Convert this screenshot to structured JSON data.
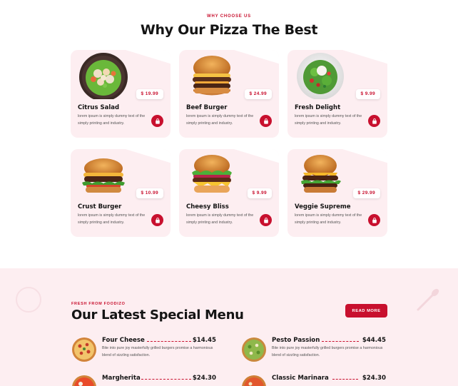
{
  "section1": {
    "eyebrow": "WHY CHOOSE US",
    "title": "Why Our Pizza The Best"
  },
  "cards": [
    {
      "name": "Citrus Salad",
      "price": "$ 19.99",
      "desc": "lorem ipsum is simply dummy text of the simply printing and industry.",
      "icon": "salad-bowl-icon"
    },
    {
      "name": "Beef Burger",
      "price": "$ 24.99",
      "desc": "lorem ipsum is simply dummy text of the simply printing and industry.",
      "icon": "burger-icon"
    },
    {
      "name": "Fresh Delight",
      "price": "$ 9.99",
      "desc": "lorem ipsum is simply dummy text of the simply printing and industry.",
      "icon": "salad-plate-icon"
    },
    {
      "name": "Crust Burger",
      "price": "$ 10.99",
      "desc": "lorem ipsum is simply dummy text of the simply printing and industry.",
      "icon": "burger-icon"
    },
    {
      "name": "Cheesy Bliss",
      "price": "$ 9.99",
      "desc": "lorem ipsum is simply dummy text of the simply printing and industry.",
      "icon": "burger-icon"
    },
    {
      "name": "Veggie Supreme",
      "price": "$ 29.99",
      "desc": "lorem ipsum is simply dummy text of the simply printing and industry.",
      "icon": "burger-icon"
    }
  ],
  "special": {
    "eyebrow": "FRESH FROM FOODIZO",
    "title": "Our Latest Special Menu",
    "read_more": "READ MORE"
  },
  "menu": [
    {
      "name": "Four Cheese",
      "price": "$14.45",
      "desc": "Bite into pure joy masterfully grilled burgers promise a harmonious blend of sizzling satisfaction."
    },
    {
      "name": "Pesto Passion",
      "price": "$44.45",
      "desc": "Bite into pure joy masterfully grilled burgers promise a harmonious blend of sizzling satisfaction."
    },
    {
      "name": "Margherita",
      "price": "$24.30",
      "desc": ""
    },
    {
      "name": "Classic Marinara",
      "price": "$24.30",
      "desc": ""
    }
  ],
  "colors": {
    "accent": "#c8102e",
    "card_bg": "#fdeef1"
  }
}
